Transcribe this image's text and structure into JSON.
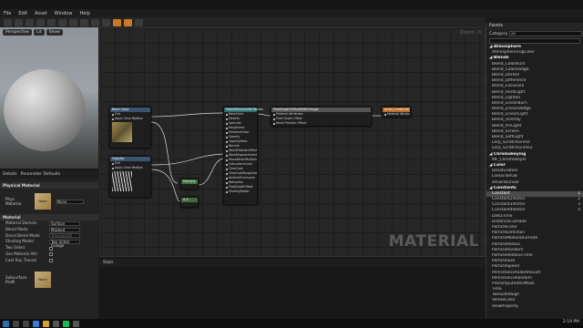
{
  "menu": [
    "File",
    "Edit",
    "Asset",
    "Window",
    "Help"
  ],
  "viewport": {
    "buttons": [
      "Perspective",
      "Lit",
      "Show"
    ]
  },
  "details": {
    "tabs": [
      "Details",
      "Parameter Defaults"
    ],
    "physical_section": "Physical Material",
    "phys_label": "Phys Material",
    "phys_value": "None",
    "material_section": "Material",
    "rows": [
      {
        "label": "Material Domain",
        "value": "Surface"
      },
      {
        "label": "Blend Mode",
        "value": "Masked"
      },
      {
        "label": "Decal Blend Mode",
        "value": "Translucent"
      },
      {
        "label": "Shading Model",
        "value": "Two Sided Foliage"
      },
      {
        "label": "Two Sided",
        "value": ""
      },
      {
        "label": "Use Material Attr",
        "value": ""
      },
      {
        "label": "Cast Ray Traced",
        "value": ""
      }
    ],
    "subsurface_label": "Subsurface Profil",
    "subsurface_value": "None"
  },
  "graph": {
    "zoom": "Zoom -3",
    "watermark": "MATERIAL",
    "nodes": {
      "base_color": {
        "title": "Base Color",
        "pins": [
          "UVs",
          "Apply View MipBias"
        ]
      },
      "opacity": {
        "title": "Opacity",
        "pins": [
          "UVs",
          "Apply View MipBias"
        ]
      },
      "main": {
        "title": "MakeMaterialAttributes",
        "pins": [
          "BaseColor",
          "Metallic",
          "Specular",
          "Roughness",
          "EmissiveColor",
          "Opacity",
          "OpacityMask",
          "Normal",
          "WorldPositionOffset",
          "WorldDisplacement",
          "TessellationMultiplier",
          "SubsurfaceColor",
          "ClearCoat",
          "ClearCoatRoughness",
          "AmbientOcclusion",
          "Refraction",
          "PixelDepthOffset",
          "ShadingModel"
        ]
      },
      "foliage": {
        "title": "PixelDepthOffsetWithFoliage",
        "pins": [
          "Material Attributes",
          "Pixel Depth Offset",
          "World Position Offset"
        ]
      },
      "output": {
        "title": "grass_tmaterial",
        "pins": [
          "Material Attributes"
        ]
      },
      "multiply": {
        "title": "Multiply"
      },
      "const": {
        "title": "0.5"
      }
    }
  },
  "stats": {
    "tab": "Stats"
  },
  "palette": {
    "tab": "Palette",
    "category_label": "Category",
    "category_value": "All",
    "items": [
      {
        "t": "Atmosphere",
        "head": true
      },
      {
        "t": "AtmosphericFogColor"
      },
      {
        "t": "Blends",
        "head": true
      },
      {
        "t": "Blend_ColorBurn"
      },
      {
        "t": "Blend_ColorDodge"
      },
      {
        "t": "Blend_Darken"
      },
      {
        "t": "Blend_Difference"
      },
      {
        "t": "Blend_Exclusion"
      },
      {
        "t": "Blend_HardLight"
      },
      {
        "t": "Blend_Lighten"
      },
      {
        "t": "Blend_LinearBurn"
      },
      {
        "t": "Blend_LinearDodge"
      },
      {
        "t": "Blend_LinearLight"
      },
      {
        "t": "Blend_Overlay"
      },
      {
        "t": "Blend_PinLight"
      },
      {
        "t": "Blend_Screen"
      },
      {
        "t": "Blend_SoftLight"
      },
      {
        "t": "Lerp_ScratchGrime"
      },
      {
        "t": "Lerp_ScratchGrime2"
      },
      {
        "t": "Chromakeying",
        "head": true
      },
      {
        "t": "MF_Chromakeyer"
      },
      {
        "t": "Color",
        "head": true
      },
      {
        "t": "Desaturation"
      },
      {
        "t": "LinearToRGB"
      },
      {
        "t": "sRGBToLinear"
      },
      {
        "t": "Constants",
        "head": true
      },
      {
        "t": "Constant",
        "sel": true,
        "hot": "1"
      },
      {
        "t": "Constant2Vector",
        "hot": "2"
      },
      {
        "t": "Constant3Vector",
        "hot": "3"
      },
      {
        "t": "Constant4Vector",
        "hot": "4"
      },
      {
        "t": "DeltaTime"
      },
      {
        "t": "DistanceCullFade"
      },
      {
        "t": "ParticleColor"
      },
      {
        "t": "ParticleDirection"
      },
      {
        "t": "ParticleMotionBlurFade"
      },
      {
        "t": "ParticleRadius"
      },
      {
        "t": "ParticleRandom"
      },
      {
        "t": "ParticleRelativeTime"
      },
      {
        "t": "ParticleSize"
      },
      {
        "t": "ParticleSpeed"
      },
      {
        "t": "PerInstanceFadeAmount"
      },
      {
        "t": "PerInstanceRandom"
      },
      {
        "t": "PrecomputedAOMask"
      },
      {
        "t": "Time"
      },
      {
        "t": "TwoSidedSign"
      },
      {
        "t": "VertexColor"
      },
      {
        "t": "ViewProperty"
      }
    ]
  },
  "taskbar": {
    "clock": "2:19 PM"
  }
}
